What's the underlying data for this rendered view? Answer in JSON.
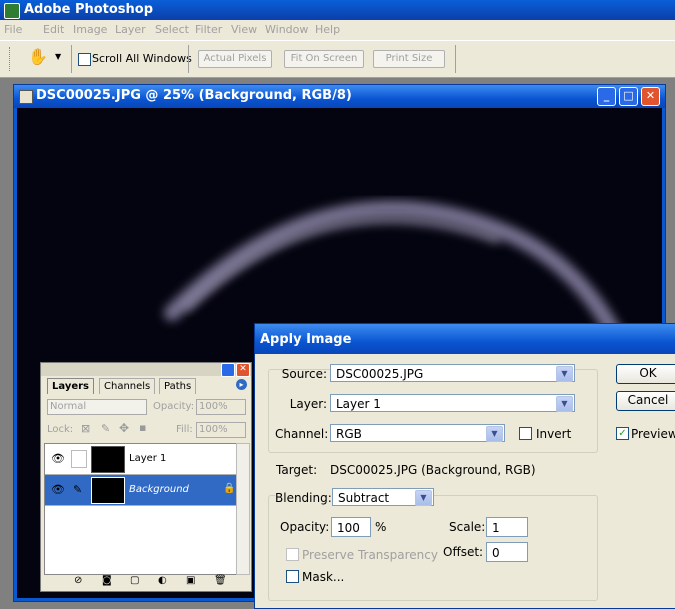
{
  "app": {
    "title": "Adobe Photoshop"
  },
  "menu": [
    "File",
    "Edit",
    "Image",
    "Layer",
    "Select",
    "Filter",
    "View",
    "Window",
    "Help"
  ],
  "options_bar": {
    "scroll_all_windows": "Scroll All Windows",
    "actual_pixels": "Actual Pixels",
    "fit_on_screen": "Fit On Screen",
    "print_size": "Print Size"
  },
  "document": {
    "title": "DSC00025.JPG @ 25% (Background, RGB/8)"
  },
  "layers_panel": {
    "tabs": [
      "Layers",
      "Channels",
      "Paths"
    ],
    "blend_mode": "Normal",
    "opacity_label": "Opacity:",
    "opacity_value": "100%",
    "lock_label": "Lock:",
    "fill_label": "Fill:",
    "fill_value": "100%",
    "layers": [
      {
        "name": "Layer 1",
        "selected": false
      },
      {
        "name": "Background",
        "selected": true,
        "locked": true
      }
    ]
  },
  "dialog": {
    "title": "Apply Image",
    "source_label": "Source:",
    "source_value": "DSC00025.JPG",
    "layer_label": "Layer:",
    "layer_value": "Layer 1",
    "channel_label": "Channel:",
    "channel_value": "RGB",
    "invert_label": "Invert",
    "invert_checked": false,
    "target_label": "Target:",
    "target_value": "DSC00025.JPG (Background, RGB)",
    "blending_label": "Blending:",
    "blending_value": "Subtract",
    "opacity_label": "Opacity:",
    "opacity_value": "100",
    "opacity_unit": "%",
    "scale_label": "Scale:",
    "scale_value": "1",
    "offset_label": "Offset:",
    "offset_value": "0",
    "preserve_transparency_label": "Preserve Transparency",
    "mask_label": "Mask...",
    "ok_label": "OK",
    "cancel_label": "Cancel",
    "preview_label": "Preview",
    "preview_checked": true
  },
  "colors": {
    "xp_blue": "#0a55d2",
    "selected_layer": "#316ac5",
    "dialog_bg": "#ece9d8"
  }
}
